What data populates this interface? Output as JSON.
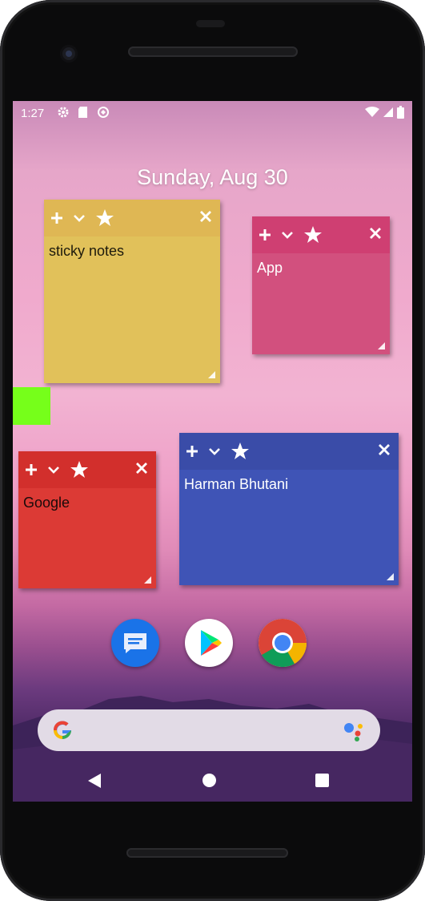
{
  "status_bar": {
    "time": "1:27"
  },
  "date": "Sunday, Aug 30",
  "notes": [
    {
      "id": "yellow",
      "text": "sticky notes",
      "color": "#e1c15a",
      "bar_color": "#dfb754"
    },
    {
      "id": "pink",
      "text": "App",
      "color": "#d2507e",
      "bar_color": "#cf3f72"
    },
    {
      "id": "red",
      "text": "Google",
      "color": "#dc3a35",
      "bar_color": "#d22f2c"
    },
    {
      "id": "blue",
      "text": "Harman Bhutani",
      "color": "#3f54b6",
      "bar_color": "#3a4ca8"
    }
  ],
  "dock_apps": [
    "messages-icon",
    "play-store-icon",
    "chrome-icon"
  ],
  "search_bar": {
    "icons": [
      "google-g-icon",
      "assistant-icon"
    ]
  },
  "colors": {
    "accent_green": "#76ff1a"
  }
}
